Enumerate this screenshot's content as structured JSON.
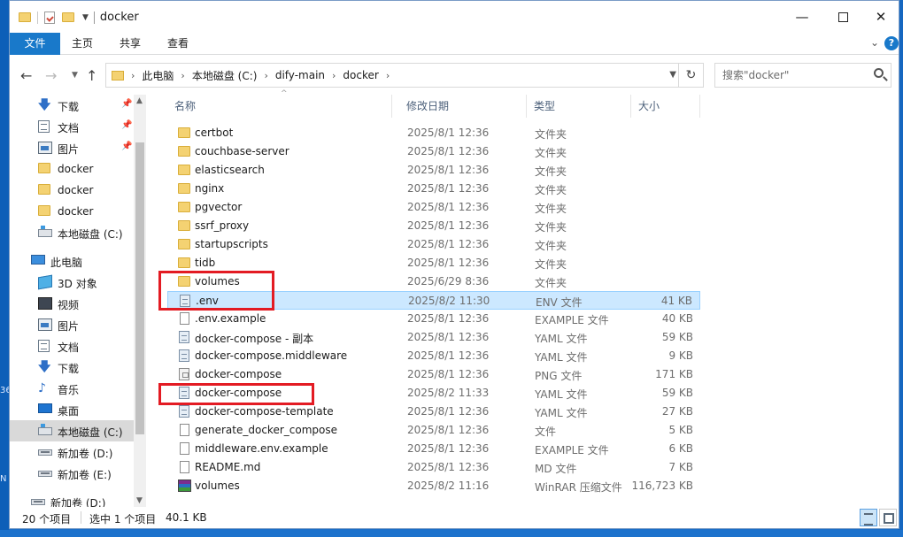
{
  "desktop": {
    "left_marks": [
      "36",
      "N"
    ]
  },
  "titlebar": {
    "title": "docker",
    "minimize": "—",
    "close": "✕"
  },
  "ribbon": {
    "tabs": [
      "文件",
      "主页",
      "共享",
      "查看"
    ],
    "help": "?"
  },
  "address": {
    "back": "←",
    "forward": "→",
    "up": "↑",
    "refresh": "↻",
    "crumbs": [
      "此电脑",
      "本地磁盘 (C:)",
      "dify-main",
      "docker"
    ]
  },
  "search": {
    "placeholder": "搜索\"docker\""
  },
  "nav_pane": {
    "items": [
      {
        "label": "下载",
        "icon": "download-icon",
        "pinned": true
      },
      {
        "label": "文档",
        "icon": "document-icon",
        "pinned": true
      },
      {
        "label": "图片",
        "icon": "pictures-icon",
        "pinned": true
      },
      {
        "label": "docker",
        "icon": "folder-icon",
        "pinned": false
      },
      {
        "label": "docker",
        "icon": "folder-icon",
        "pinned": false
      },
      {
        "label": "docker",
        "icon": "folder-icon",
        "pinned": false
      },
      {
        "label": "本地磁盘 (C:)",
        "icon": "drive-icon",
        "pinned": false
      },
      {
        "label": "此电脑",
        "icon": "computer-icon",
        "pinned": false
      },
      {
        "label": "3D 对象",
        "icon": "3d-objects-icon",
        "pinned": false
      },
      {
        "label": "视频",
        "icon": "video-icon",
        "pinned": false
      },
      {
        "label": "图片",
        "icon": "pictures-icon",
        "pinned": false
      },
      {
        "label": "文档",
        "icon": "document-icon",
        "pinned": false
      },
      {
        "label": "下载",
        "icon": "download-icon",
        "pinned": false
      },
      {
        "label": "音乐",
        "icon": "music-icon",
        "pinned": false
      },
      {
        "label": "桌面",
        "icon": "desktop-icon",
        "pinned": false
      },
      {
        "label": "本地磁盘 (C:)",
        "icon": "drive-icon",
        "pinned": false,
        "selected": true
      },
      {
        "label": "新加卷 (D:)",
        "icon": "volume-icon",
        "pinned": false
      },
      {
        "label": "新加卷 (E:)",
        "icon": "volume-icon",
        "pinned": false
      },
      {
        "label": "新加卷 (D:)",
        "icon": "volume-icon",
        "pinned": false
      }
    ]
  },
  "columns": {
    "name": "名称",
    "date": "修改日期",
    "type": "类型",
    "size": "大小"
  },
  "files": [
    {
      "name": "certbot",
      "date": "2025/8/1 12:36",
      "type": "文件夹",
      "size": "",
      "icon": "folder"
    },
    {
      "name": "couchbase-server",
      "date": "2025/8/1 12:36",
      "type": "文件夹",
      "size": "",
      "icon": "folder"
    },
    {
      "name": "elasticsearch",
      "date": "2025/8/1 12:36",
      "type": "文件夹",
      "size": "",
      "icon": "folder"
    },
    {
      "name": "nginx",
      "date": "2025/8/1 12:36",
      "type": "文件夹",
      "size": "",
      "icon": "folder"
    },
    {
      "name": "pgvector",
      "date": "2025/8/1 12:36",
      "type": "文件夹",
      "size": "",
      "icon": "folder"
    },
    {
      "name": "ssrf_proxy",
      "date": "2025/8/1 12:36",
      "type": "文件夹",
      "size": "",
      "icon": "folder"
    },
    {
      "name": "startupscripts",
      "date": "2025/8/1 12:36",
      "type": "文件夹",
      "size": "",
      "icon": "folder"
    },
    {
      "name": "tidb",
      "date": "2025/8/1 12:36",
      "type": "文件夹",
      "size": "",
      "icon": "folder"
    },
    {
      "name": "volumes",
      "date": "2025/6/29 8:36",
      "type": "文件夹",
      "size": "",
      "icon": "folder"
    },
    {
      "name": ".env",
      "date": "2025/8/2 11:30",
      "type": "ENV 文件",
      "size": "41 KB",
      "icon": "yaml",
      "selected": true
    },
    {
      "name": ".env.example",
      "date": "2025/8/1 12:36",
      "type": "EXAMPLE 文件",
      "size": "40 KB",
      "icon": "file"
    },
    {
      "name": "docker-compose - 副本",
      "date": "2025/8/1 12:36",
      "type": "YAML 文件",
      "size": "59 KB",
      "icon": "yaml"
    },
    {
      "name": "docker-compose.middleware",
      "date": "2025/8/1 12:36",
      "type": "YAML 文件",
      "size": "9 KB",
      "icon": "yaml"
    },
    {
      "name": "docker-compose",
      "date": "2025/8/1 12:36",
      "type": "PNG 文件",
      "size": "171 KB",
      "icon": "png"
    },
    {
      "name": "docker-compose",
      "date": "2025/8/2 11:33",
      "type": "YAML 文件",
      "size": "59 KB",
      "icon": "yaml"
    },
    {
      "name": "docker-compose-template",
      "date": "2025/8/1 12:36",
      "type": "YAML 文件",
      "size": "27 KB",
      "icon": "yaml"
    },
    {
      "name": "generate_docker_compose",
      "date": "2025/8/1 12:36",
      "type": "文件",
      "size": "5 KB",
      "icon": "file"
    },
    {
      "name": "middleware.env.example",
      "date": "2025/8/1 12:36",
      "type": "EXAMPLE 文件",
      "size": "6 KB",
      "icon": "file"
    },
    {
      "name": "README.md",
      "date": "2025/8/1 12:36",
      "type": "MD 文件",
      "size": "7 KB",
      "icon": "file"
    },
    {
      "name": "volumes",
      "date": "2025/8/2 11:16",
      "type": "WinRAR 压缩文件",
      "size": "116,723 KB",
      "icon": "rar"
    }
  ],
  "statusbar": {
    "count": "20 个项目",
    "selection": "选中 1 个项目",
    "size": "40.1 KB"
  },
  "colors": {
    "accent": "#1979ca",
    "selected_row": "#cce8ff",
    "highlight_box": "#e31b23"
  }
}
